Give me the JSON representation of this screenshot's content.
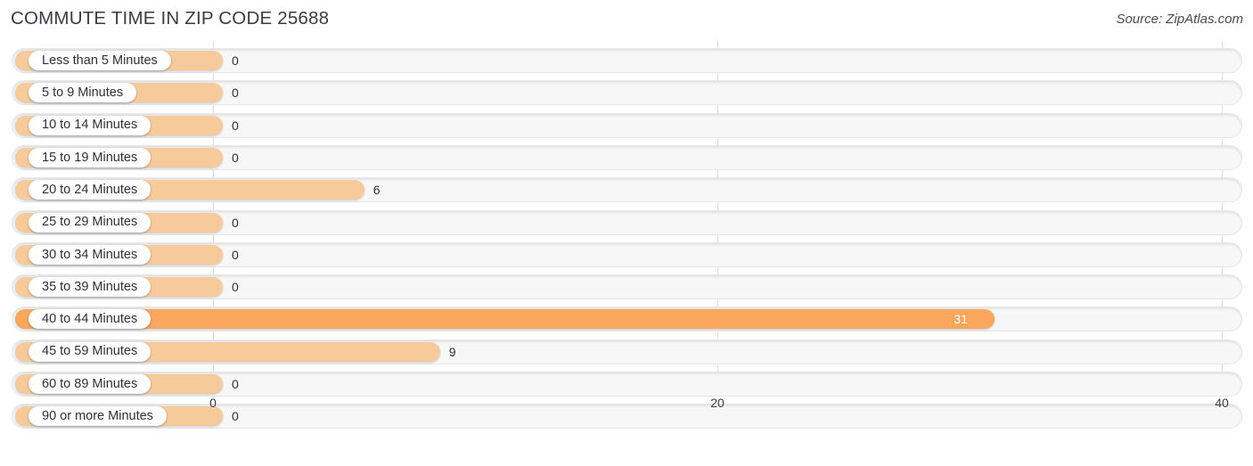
{
  "header": {
    "title": "COMMUTE TIME IN ZIP CODE 25688",
    "source": "Source: ZipAtlas.com"
  },
  "colors": {
    "bar_light": "#F7CA9B",
    "bar_highlight": "#FAA65D",
    "track": "#F7F7F7",
    "gridline": "#DCDCDC",
    "text": "#2F2F38"
  },
  "chart_data": {
    "type": "bar",
    "orientation": "horizontal",
    "title": "COMMUTE TIME IN ZIP CODE 25688",
    "xlabel": "",
    "ylabel": "",
    "xlim": [
      0,
      40
    ],
    "grid": true,
    "legend": null,
    "axis_ticks": [
      "0",
      "20",
      "40"
    ],
    "axis_tick_values": [
      0,
      20,
      40
    ],
    "categories": [
      "Less than 5 Minutes",
      "5 to 9 Minutes",
      "10 to 14 Minutes",
      "15 to 19 Minutes",
      "20 to 24 Minutes",
      "25 to 29 Minutes",
      "30 to 34 Minutes",
      "35 to 39 Minutes",
      "40 to 44 Minutes",
      "45 to 59 Minutes",
      "60 to 89 Minutes",
      "90 or more Minutes"
    ],
    "values": [
      0,
      0,
      0,
      0,
      6,
      0,
      0,
      0,
      31,
      9,
      0,
      0
    ],
    "value_labels": [
      "0",
      "0",
      "0",
      "0",
      "6",
      "0",
      "0",
      "0",
      "31",
      "9",
      "0",
      "0"
    ],
    "highlight_index": 8
  }
}
